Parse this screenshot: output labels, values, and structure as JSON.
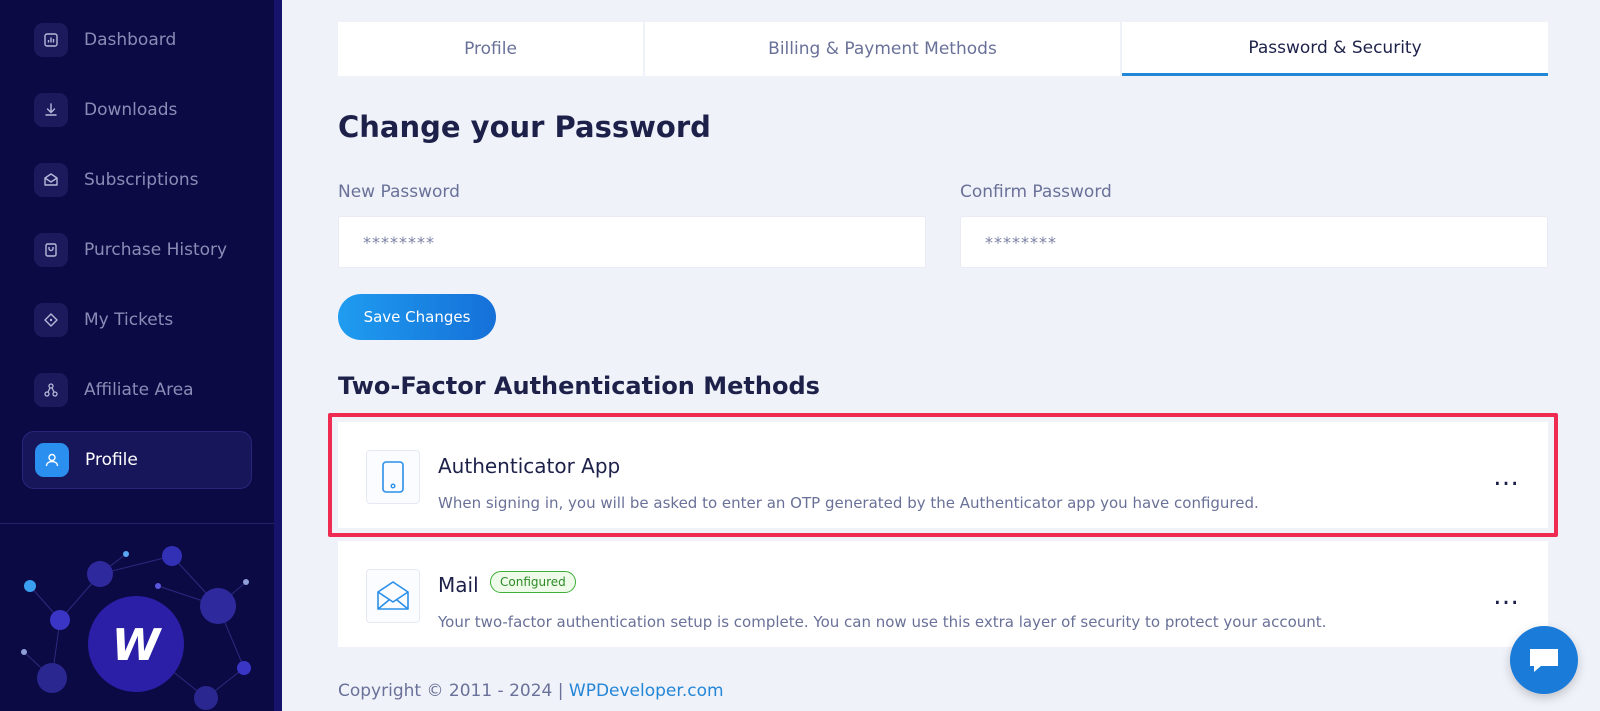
{
  "sidebar": {
    "items": [
      {
        "label": "Dashboard",
        "icon": "dashboard-icon"
      },
      {
        "label": "Downloads",
        "icon": "download-icon"
      },
      {
        "label": "Subscriptions",
        "icon": "subscriptions-icon"
      },
      {
        "label": "Purchase History",
        "icon": "purchase-history-icon"
      },
      {
        "label": "My Tickets",
        "icon": "ticket-icon"
      },
      {
        "label": "Affiliate Area",
        "icon": "affiliate-icon"
      },
      {
        "label": "Profile",
        "icon": "user-icon",
        "active": true
      }
    ]
  },
  "tabs": [
    {
      "label": "Profile"
    },
    {
      "label": "Billing & Payment Methods"
    },
    {
      "label": "Password & Security",
      "active": true
    }
  ],
  "password": {
    "heading": "Change your Password",
    "new_label": "New Password",
    "new_value": "********",
    "confirm_label": "Confirm Password",
    "confirm_value": "********",
    "save_label": "Save Changes"
  },
  "two_factor": {
    "heading": "Two-Factor Authentication Methods",
    "methods": [
      {
        "title": "Authenticator App",
        "description": "When signing in, you will be asked to enter an OTP generated by the Authenticator app you have configured.",
        "icon": "mobile-phone-icon",
        "more": "…"
      },
      {
        "title": "Mail",
        "badge": "Configured",
        "description": "Your two-factor authentication setup is complete. You can now use this extra layer of security to protect your account.",
        "icon": "mail-icon",
        "more": "…"
      }
    ]
  },
  "footer": {
    "copyright": "Copyright © 2011 - 2024 | ",
    "link": "WPDeveloper.com"
  },
  "colors": {
    "sidebar_bg": "#0c0a45",
    "accent": "#2386d6",
    "highlight": "#ef2b52",
    "badge_green": "#3eae38"
  }
}
